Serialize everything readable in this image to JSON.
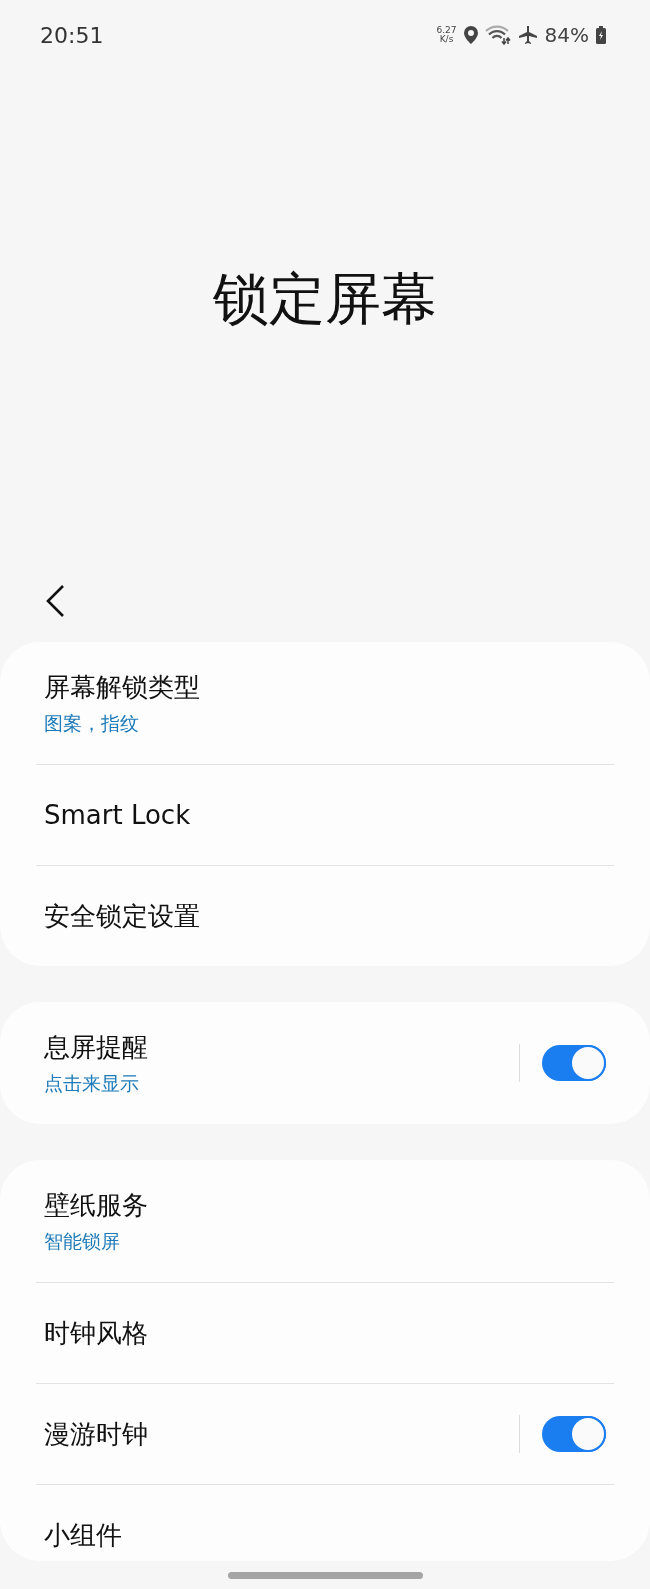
{
  "status_bar": {
    "time": "20:51",
    "speed_value": "6.27",
    "speed_unit": "K/s",
    "battery": "84%"
  },
  "title": "锁定屏幕",
  "groups": [
    {
      "items": [
        {
          "kind": "nav",
          "label": "屏幕解锁类型",
          "subtitle": "图案，指纹"
        },
        {
          "kind": "nav",
          "label": "Smart Lock"
        },
        {
          "kind": "nav",
          "label": "安全锁定设置"
        }
      ]
    },
    {
      "items": [
        {
          "kind": "toggle",
          "label": "息屏提醒",
          "subtitle": "点击来显示",
          "on": true
        }
      ]
    },
    {
      "items": [
        {
          "kind": "nav",
          "label": "壁纸服务",
          "subtitle": "智能锁屏"
        },
        {
          "kind": "nav",
          "label": "时钟风格"
        },
        {
          "kind": "toggle",
          "label": "漫游时钟",
          "on": true
        },
        {
          "kind": "nav",
          "label": "小组件"
        }
      ]
    }
  ]
}
